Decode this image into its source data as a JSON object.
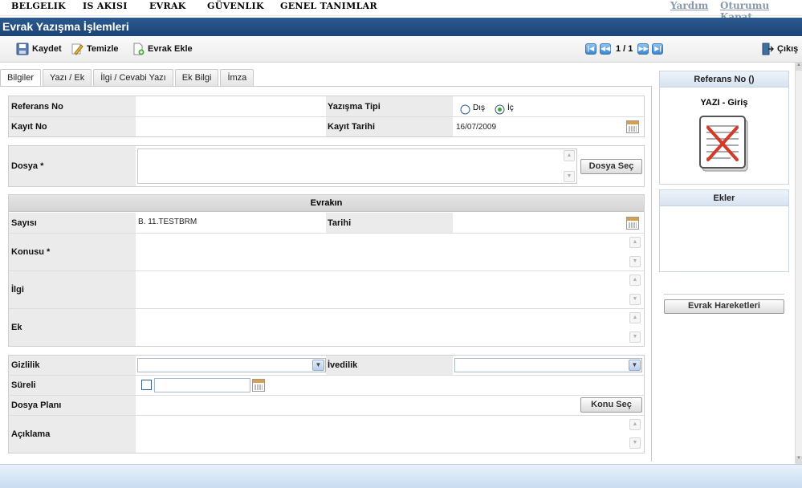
{
  "menu": {
    "items": [
      "BELGELIK",
      "IS AKISI",
      "EVRAK",
      "GÜVENLIK",
      "GENEL TANIMLAR"
    ],
    "help": "Yardım",
    "logout": "Oturumu Kapat"
  },
  "page_title": "Evrak Yazışma İşlemleri",
  "toolbar": {
    "save": "Kaydet",
    "clear": "Temizle",
    "add_doc": "Evrak Ekle",
    "pager": "1 / 1",
    "exit": "Çıkış"
  },
  "tabs": [
    "Bilgiler",
    "Yazı / Ek",
    "İlgi / Cevabi Yazı",
    "Ek Bilgi",
    "İmza"
  ],
  "form": {
    "ref_no_label": "Referans No",
    "type_label": "Yazışma Tipi",
    "type_options": [
      "Dış",
      "İç"
    ],
    "type_selected": "İç",
    "record_no_label": "Kayıt No",
    "record_date_label": "Kayıt Tarihi",
    "record_date_value": "16/07/2009",
    "file_label": "Dosya *",
    "file_button": "Dosya Seç",
    "section_title": "Evrakın",
    "number_label": "Sayısı",
    "number_value": "B. 11.TESTBRM",
    "date_label": "Tarihi",
    "subject_label": "Konusu *",
    "related_label": "İlgi",
    "attachment_label": "Ek",
    "privacy_label": "Gizlilik",
    "urgency_label": "İvedilik",
    "duration_label": "Süreli",
    "file_plan_label": "Dosya Planı",
    "topic_button": "Konu Seç",
    "description_label": "Açıklama"
  },
  "side": {
    "ref_title": "Referans No ()",
    "doc_type": "YAZI - Giriş",
    "attachments_title": "Ekler",
    "history_button": "Evrak Hareketleri"
  }
}
